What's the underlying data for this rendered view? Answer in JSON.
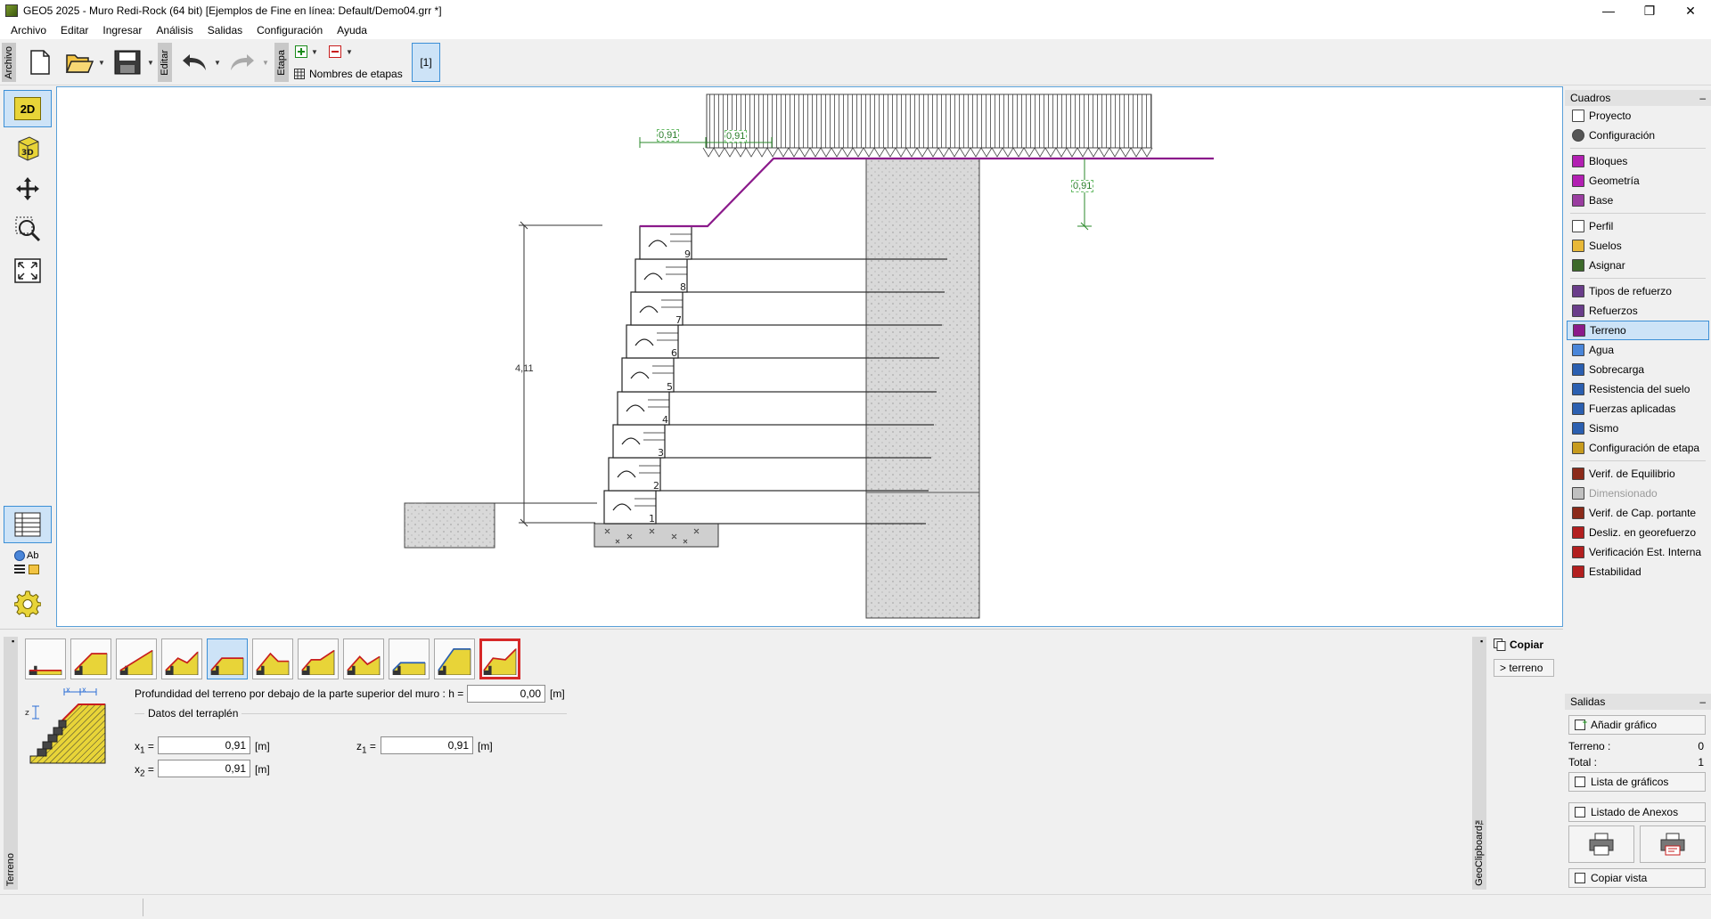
{
  "window": {
    "title": "GEO5 2025 - Muro Redi-Rock  (64 bit) [Ejemplos de Fine en línea: Default/Demo04.grr *]",
    "minimize": "—",
    "restore": "❐",
    "close": "✕"
  },
  "menu": [
    "Archivo",
    "Editar",
    "Ingresar",
    "Análisis",
    "Salidas",
    "Configuración",
    "Ayuda"
  ],
  "toolbar": {
    "archivo_tab": "Archivo",
    "editar_tab": "Editar",
    "etapa_tab": "Etapa",
    "stage_names_label": "Nombres de etapas",
    "stage_current": "[1]"
  },
  "palette": {
    "view2d": "2D",
    "view3d": "3D",
    "table_text": "Ab"
  },
  "drawing": {
    "dim_height": "4,11",
    "dim_x1": "0,91",
    "dim_x2": "0,91",
    "dim_z1": "0,91",
    "block_numbers": [
      "1",
      "2",
      "3",
      "4",
      "5",
      "6",
      "7",
      "8",
      "9"
    ]
  },
  "frames": {
    "header": "Cuadros",
    "collapse": "–",
    "groups": [
      [
        {
          "label": "Proyecto",
          "icon": "document-icon",
          "state": "normal"
        },
        {
          "label": "Configuración",
          "icon": "gear-icon",
          "state": "normal"
        }
      ],
      [
        {
          "label": "Bloques",
          "icon": "blocks-icon",
          "state": "normal"
        },
        {
          "label": "Geometría",
          "icon": "geometry-icon",
          "state": "normal"
        },
        {
          "label": "Base",
          "icon": "base-icon",
          "state": "normal"
        }
      ],
      [
        {
          "label": "Perfil",
          "icon": "profile-icon",
          "state": "normal"
        },
        {
          "label": "Suelos",
          "icon": "soils-icon",
          "state": "normal"
        },
        {
          "label": "Asignar",
          "icon": "assign-icon",
          "state": "normal"
        }
      ],
      [
        {
          "label": "Tipos de refuerzo",
          "icon": "reinforcement-types-icon",
          "state": "normal"
        },
        {
          "label": "Refuerzos",
          "icon": "reinforcements-icon",
          "state": "normal"
        },
        {
          "label": "Terreno",
          "icon": "terrain-icon",
          "state": "selected"
        },
        {
          "label": "Agua",
          "icon": "water-icon",
          "state": "normal"
        },
        {
          "label": "Sobrecarga",
          "icon": "surcharge-icon",
          "state": "normal"
        },
        {
          "label": "Resistencia del suelo",
          "icon": "soil-resistance-icon",
          "state": "normal"
        },
        {
          "label": "Fuerzas aplicadas",
          "icon": "applied-forces-icon",
          "state": "normal"
        },
        {
          "label": "Sismo",
          "icon": "earthquake-icon",
          "state": "normal"
        },
        {
          "label": "Configuración de etapa",
          "icon": "stage-settings-icon",
          "state": "normal"
        }
      ],
      [
        {
          "label": "Verif. de Equilibrio",
          "icon": "equilibrium-icon",
          "state": "normal"
        },
        {
          "label": "Dimensionado",
          "icon": "dimensioning-icon",
          "state": "disabled"
        },
        {
          "label": "Verif. de Cap. portante",
          "icon": "bearing-capacity-icon",
          "state": "normal"
        },
        {
          "label": "Desliz. en georefuerzo",
          "icon": "sliding-icon",
          "state": "normal"
        },
        {
          "label": "Verificación Est. Interna",
          "icon": "internal-stability-icon",
          "state": "normal"
        },
        {
          "label": "Estabilidad",
          "icon": "stability-icon",
          "state": "normal"
        }
      ]
    ]
  },
  "outputs": {
    "header": "Salidas",
    "collapse": "–",
    "add_picture": "Añadir gráfico",
    "terrain_label": "Terreno :",
    "terrain_count": "0",
    "total_label": "Total :",
    "total_count": "1",
    "list_pictures": "Lista de gráficos",
    "list_annexes": "Listado de Anexos",
    "copy_view": "Copiar vista"
  },
  "clipboard": {
    "tab": "GeoClipboard™",
    "copy": "Copiar",
    "terrain": "> terreno"
  },
  "terrain_frame": {
    "tab": "Terreno",
    "depth_label": "Profundidad del terreno por debajo de la parte superior del muro : h =",
    "depth_value": "0,00",
    "unit": "[m]",
    "group_title": "Datos del terraplén",
    "x1_label": "x",
    "x1_sub": "1",
    "x1_value": "0,91",
    "x2_label": "x",
    "x2_sub": "2",
    "x2_value": "0,91",
    "z1_label": "z",
    "z1_sub": "1",
    "z1_value": "0,91",
    "shape_count": 11,
    "active_shape": 5,
    "selected_shape": 11
  }
}
